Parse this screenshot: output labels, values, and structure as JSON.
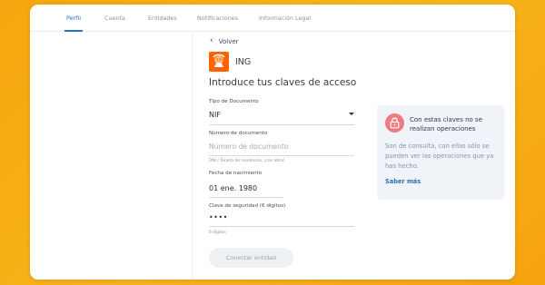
{
  "tabs": [
    {
      "label": "Perfil",
      "active": true
    },
    {
      "label": "Cuenta",
      "active": false
    },
    {
      "label": "Entidades",
      "active": false
    },
    {
      "label": "Notificaciones",
      "active": false
    },
    {
      "label": "Información Legal",
      "active": false
    }
  ],
  "back_label": "Volver",
  "bank": {
    "name": "ING",
    "logo_icon": "ing-lion-logo",
    "logo_color": "#ff6200"
  },
  "heading": "Introduce tus claves de acceso",
  "form": {
    "doc_type": {
      "label": "Tipo de Documento",
      "value": "NIF"
    },
    "doc_number": {
      "label": "Número de documento",
      "placeholder": "Número de documento",
      "hint": "DNI / Tarjeta de residencia, ¡con letra!"
    },
    "birth_date": {
      "label": "Fecha de nacimiento",
      "value": "01 ene. 1980"
    },
    "security_key": {
      "label": "Clave de seguridad (6 dígitos)",
      "value": "••••",
      "hint": "6 dígitos"
    },
    "submit_label": "Conectar entidad"
  },
  "info": {
    "icon": "lock-icon",
    "title": "Con estas claves no se realizan operaciones",
    "text": "Son de consulta, con ellas sólo se pueden ver las operaciones que ya has hecho.",
    "link": "Saber más"
  },
  "colors": {
    "accent": "#2d6fb8",
    "background": "#f7ac15",
    "lock_badge": "#ee7b80"
  }
}
